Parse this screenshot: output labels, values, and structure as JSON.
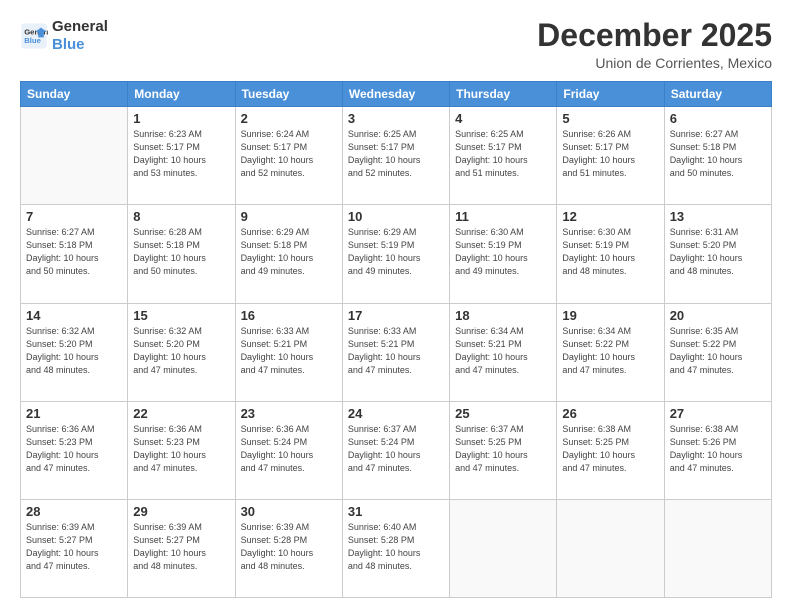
{
  "logo": {
    "line1": "General",
    "line2": "Blue"
  },
  "header": {
    "month": "December 2025",
    "location": "Union de Corrientes, Mexico"
  },
  "weekdays": [
    "Sunday",
    "Monday",
    "Tuesday",
    "Wednesday",
    "Thursday",
    "Friday",
    "Saturday"
  ],
  "weeks": [
    [
      {
        "day": "",
        "info": ""
      },
      {
        "day": "1",
        "info": "Sunrise: 6:23 AM\nSunset: 5:17 PM\nDaylight: 10 hours\nand 53 minutes."
      },
      {
        "day": "2",
        "info": "Sunrise: 6:24 AM\nSunset: 5:17 PM\nDaylight: 10 hours\nand 52 minutes."
      },
      {
        "day": "3",
        "info": "Sunrise: 6:25 AM\nSunset: 5:17 PM\nDaylight: 10 hours\nand 52 minutes."
      },
      {
        "day": "4",
        "info": "Sunrise: 6:25 AM\nSunset: 5:17 PM\nDaylight: 10 hours\nand 51 minutes."
      },
      {
        "day": "5",
        "info": "Sunrise: 6:26 AM\nSunset: 5:17 PM\nDaylight: 10 hours\nand 51 minutes."
      },
      {
        "day": "6",
        "info": "Sunrise: 6:27 AM\nSunset: 5:18 PM\nDaylight: 10 hours\nand 50 minutes."
      }
    ],
    [
      {
        "day": "7",
        "info": "Sunrise: 6:27 AM\nSunset: 5:18 PM\nDaylight: 10 hours\nand 50 minutes."
      },
      {
        "day": "8",
        "info": "Sunrise: 6:28 AM\nSunset: 5:18 PM\nDaylight: 10 hours\nand 50 minutes."
      },
      {
        "day": "9",
        "info": "Sunrise: 6:29 AM\nSunset: 5:18 PM\nDaylight: 10 hours\nand 49 minutes."
      },
      {
        "day": "10",
        "info": "Sunrise: 6:29 AM\nSunset: 5:19 PM\nDaylight: 10 hours\nand 49 minutes."
      },
      {
        "day": "11",
        "info": "Sunrise: 6:30 AM\nSunset: 5:19 PM\nDaylight: 10 hours\nand 49 minutes."
      },
      {
        "day": "12",
        "info": "Sunrise: 6:30 AM\nSunset: 5:19 PM\nDaylight: 10 hours\nand 48 minutes."
      },
      {
        "day": "13",
        "info": "Sunrise: 6:31 AM\nSunset: 5:20 PM\nDaylight: 10 hours\nand 48 minutes."
      }
    ],
    [
      {
        "day": "14",
        "info": "Sunrise: 6:32 AM\nSunset: 5:20 PM\nDaylight: 10 hours\nand 48 minutes."
      },
      {
        "day": "15",
        "info": "Sunrise: 6:32 AM\nSunset: 5:20 PM\nDaylight: 10 hours\nand 47 minutes."
      },
      {
        "day": "16",
        "info": "Sunrise: 6:33 AM\nSunset: 5:21 PM\nDaylight: 10 hours\nand 47 minutes."
      },
      {
        "day": "17",
        "info": "Sunrise: 6:33 AM\nSunset: 5:21 PM\nDaylight: 10 hours\nand 47 minutes."
      },
      {
        "day": "18",
        "info": "Sunrise: 6:34 AM\nSunset: 5:21 PM\nDaylight: 10 hours\nand 47 minutes."
      },
      {
        "day": "19",
        "info": "Sunrise: 6:34 AM\nSunset: 5:22 PM\nDaylight: 10 hours\nand 47 minutes."
      },
      {
        "day": "20",
        "info": "Sunrise: 6:35 AM\nSunset: 5:22 PM\nDaylight: 10 hours\nand 47 minutes."
      }
    ],
    [
      {
        "day": "21",
        "info": "Sunrise: 6:36 AM\nSunset: 5:23 PM\nDaylight: 10 hours\nand 47 minutes."
      },
      {
        "day": "22",
        "info": "Sunrise: 6:36 AM\nSunset: 5:23 PM\nDaylight: 10 hours\nand 47 minutes."
      },
      {
        "day": "23",
        "info": "Sunrise: 6:36 AM\nSunset: 5:24 PM\nDaylight: 10 hours\nand 47 minutes."
      },
      {
        "day": "24",
        "info": "Sunrise: 6:37 AM\nSunset: 5:24 PM\nDaylight: 10 hours\nand 47 minutes."
      },
      {
        "day": "25",
        "info": "Sunrise: 6:37 AM\nSunset: 5:25 PM\nDaylight: 10 hours\nand 47 minutes."
      },
      {
        "day": "26",
        "info": "Sunrise: 6:38 AM\nSunset: 5:25 PM\nDaylight: 10 hours\nand 47 minutes."
      },
      {
        "day": "27",
        "info": "Sunrise: 6:38 AM\nSunset: 5:26 PM\nDaylight: 10 hours\nand 47 minutes."
      }
    ],
    [
      {
        "day": "28",
        "info": "Sunrise: 6:39 AM\nSunset: 5:27 PM\nDaylight: 10 hours\nand 47 minutes."
      },
      {
        "day": "29",
        "info": "Sunrise: 6:39 AM\nSunset: 5:27 PM\nDaylight: 10 hours\nand 48 minutes."
      },
      {
        "day": "30",
        "info": "Sunrise: 6:39 AM\nSunset: 5:28 PM\nDaylight: 10 hours\nand 48 minutes."
      },
      {
        "day": "31",
        "info": "Sunrise: 6:40 AM\nSunset: 5:28 PM\nDaylight: 10 hours\nand 48 minutes."
      },
      {
        "day": "",
        "info": ""
      },
      {
        "day": "",
        "info": ""
      },
      {
        "day": "",
        "info": ""
      }
    ]
  ]
}
